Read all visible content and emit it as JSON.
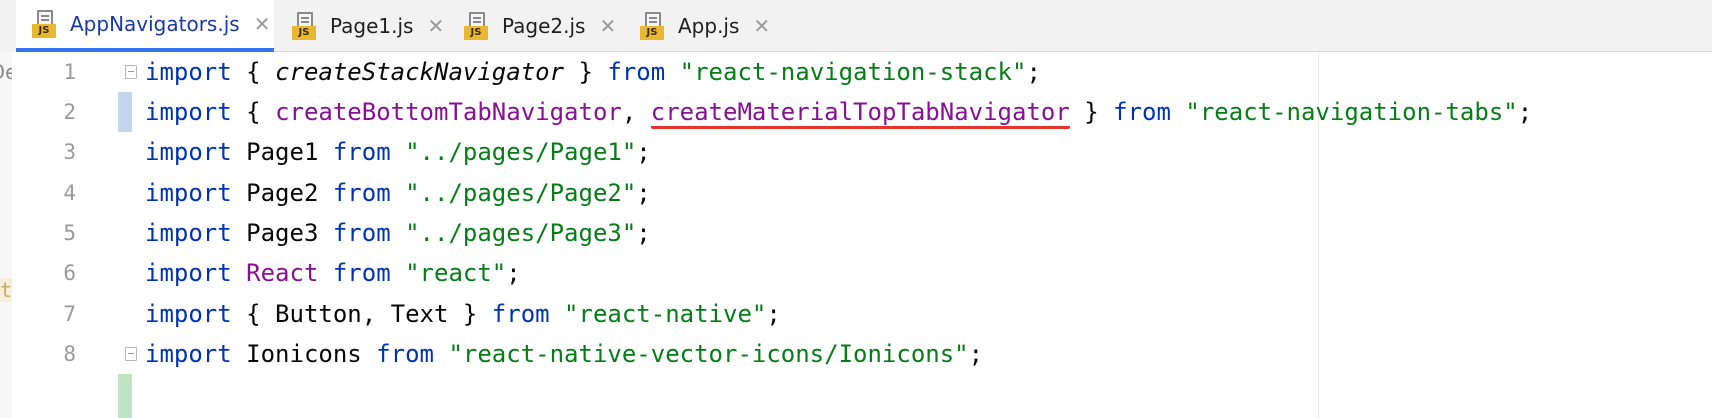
{
  "tabs": [
    {
      "label": "AppNavigators.js",
      "active": true,
      "close": "✕",
      "badge": "JS"
    },
    {
      "label": "Page1.js",
      "active": false,
      "close": "✕",
      "badge": "JS"
    },
    {
      "label": "Page2.js",
      "active": false,
      "close": "✕",
      "badge": "JS"
    },
    {
      "label": "App.js",
      "active": false,
      "close": "✕",
      "badge": "JS"
    }
  ],
  "left_strip": {
    "fragment_1": "De",
    "fragment_2": "t"
  },
  "line_numbers": [
    "1",
    "2",
    "3",
    "4",
    "5",
    "6",
    "7",
    "8"
  ],
  "code": {
    "l1": {
      "kw": "import",
      "open": " { ",
      "name": "createStackNavigator",
      "close": " } ",
      "from": "from",
      "sp": " ",
      "str": "\"react-navigation-stack\"",
      "end": ";"
    },
    "l2": {
      "kw": "import",
      "open": " { ",
      "name1": "createBottomTabNavigator",
      "comma": ", ",
      "name2": "createMaterialTopTabNavigator",
      "close": " } ",
      "from": "from",
      "sp": " ",
      "str": "\"react-navigation-tabs\"",
      "end": ";"
    },
    "l3": {
      "kw": "import",
      "name": " Page1 ",
      "from": "from",
      "sp": " ",
      "str": "\"../pages/Page1\"",
      "end": ";"
    },
    "l4": {
      "kw": "import",
      "name": " Page2 ",
      "from": "from",
      "sp": " ",
      "str": "\"../pages/Page2\"",
      "end": ";"
    },
    "l5": {
      "kw": "import",
      "name": " Page3 ",
      "from": "from",
      "sp": " ",
      "str": "\"../pages/Page3\"",
      "end": ";"
    },
    "l6": {
      "kw": "import",
      "sp1": " ",
      "name": "React",
      "sp2": " ",
      "from": "from",
      "sp": " ",
      "str": "\"react\"",
      "end": ";"
    },
    "l7": {
      "kw": "import",
      "name": " { Button, Text } ",
      "from": "from",
      "sp": " ",
      "str": "\"react-native\"",
      "end": ";"
    },
    "l8": {
      "kw": "import",
      "name": " Ionicons ",
      "from": "from",
      "sp": " ",
      "str": "\"react-native-vector-icons/Ionicons\"",
      "end": ";"
    }
  },
  "colors": {
    "keyword": "#0033b3",
    "string": "#067d17",
    "identifier": "#871094",
    "annotation_underline": "#e8322b",
    "active_tab_indicator": "#3574f0"
  }
}
